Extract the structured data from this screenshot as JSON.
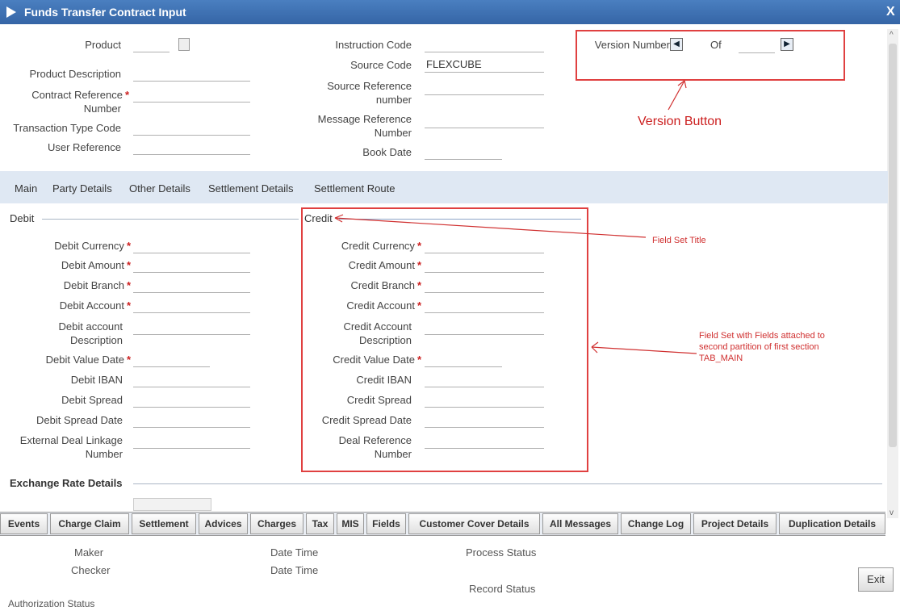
{
  "window": {
    "title": "Funds Transfer Contract Input",
    "close": "X"
  },
  "header": {
    "product": "Product",
    "product_description": "Product Description",
    "contract_reference": "Contract Reference",
    "contract_reference_2": "Number",
    "transaction_type_code": "Transaction Type Code",
    "user_reference": "User Reference",
    "instruction_code": "Instruction Code",
    "source_code": "Source Code",
    "source_code_value": "FLEXCUBE",
    "source_reference": "Source Reference",
    "source_reference_2": "number",
    "message_reference": "Message Reference",
    "message_reference_2": "Number",
    "book_date": "Book Date",
    "version_number": "Version Number",
    "of": "Of"
  },
  "tabs": [
    "Main",
    "Party Details",
    "Other Details",
    "Settlement Details",
    "Settlement Route"
  ],
  "debit": {
    "title": "Debit",
    "currency": "Debit Currency",
    "amount": "Debit Amount",
    "branch": "Debit Branch",
    "account": "Debit Account",
    "account_desc": "Debit account",
    "account_desc_2": "Description",
    "value_date": "Debit Value Date",
    "iban": "Debit IBAN",
    "spread": "Debit Spread",
    "spread_date": "Debit Spread Date",
    "ext_deal": "External Deal Linkage",
    "ext_deal_2": "Number"
  },
  "credit": {
    "title": "Credit",
    "currency": "Credit Currency",
    "amount": "Credit Amount",
    "branch": "Credit Branch",
    "account": "Credit Account",
    "account_desc": "Credit Account",
    "account_desc_2": "Description",
    "value_date": "Credit Value Date",
    "iban": "Credit IBAN",
    "spread": "Credit Spread",
    "spread_date": "Credit Spread Date",
    "deal_ref": "Deal Reference",
    "deal_ref_2": "Number"
  },
  "exchange_rate_details": "Exchange Rate Details",
  "annotations": {
    "version_button": "Version Button",
    "field_set_title": "Field Set Title",
    "field_set_fields_1": "Field Set with Fields attached to",
    "field_set_fields_2": "second partition of first section",
    "field_set_fields_3": "TAB_MAIN"
  },
  "buttons": [
    "Events",
    "Charge Claim",
    "Settlement",
    "Advices",
    "Charges",
    "Tax",
    "MIS",
    "Fields",
    "Customer Cover Details",
    "All Messages",
    "Change Log",
    "Project Details",
    "Duplication Details"
  ],
  "footer": {
    "maker": "Maker",
    "checker": "Checker",
    "date_time_1": "Date Time",
    "date_time_2": "Date Time",
    "process_status": "Process Status",
    "record_status": "Record Status",
    "authorization_status": "Authorization Status",
    "exit": "Exit"
  },
  "required_mark": "*",
  "colors": {
    "titlebar": "#3d6fb0",
    "tabs_bg": "#dfe8f3",
    "annotation": "#e04040"
  }
}
